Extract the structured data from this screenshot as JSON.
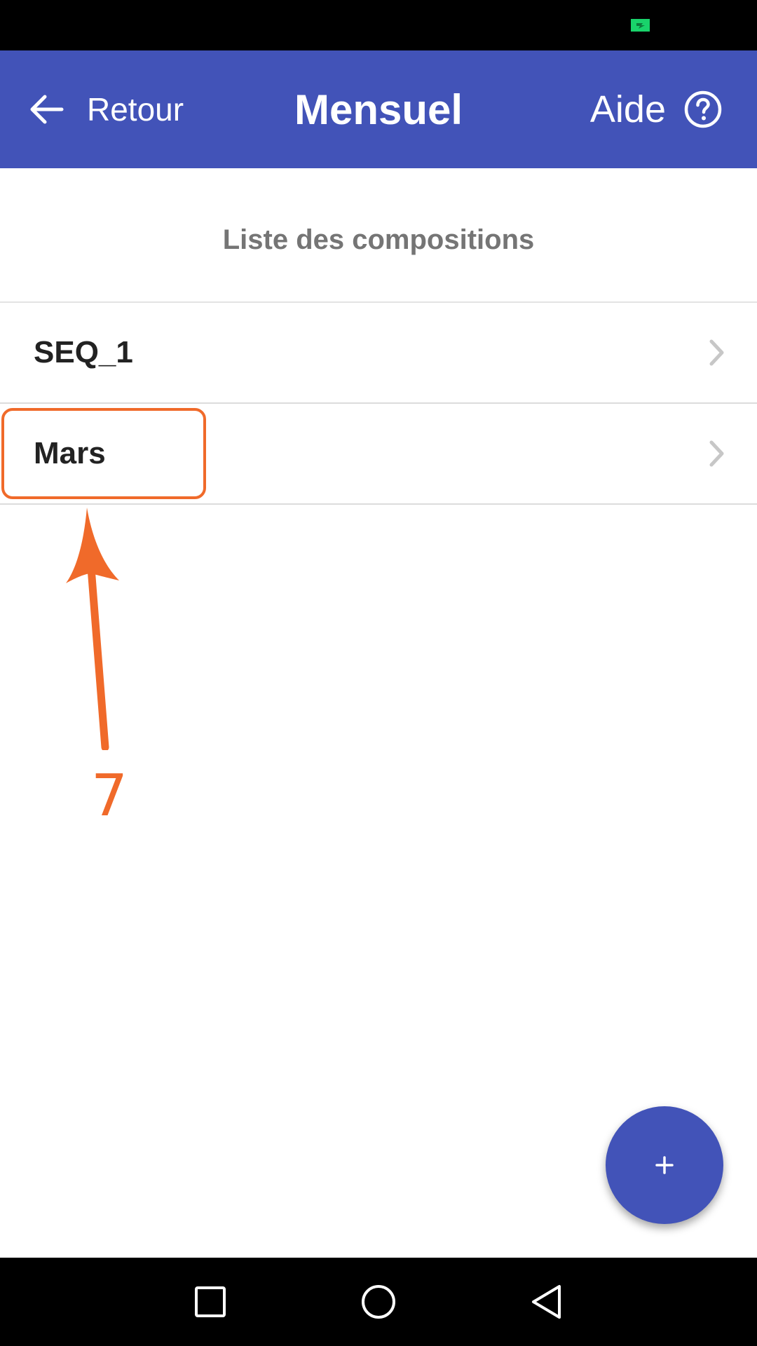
{
  "status_bar": {
    "battery_icon": "battery-charging-icon",
    "battery_color": "#19d36b"
  },
  "app_bar": {
    "back_label": "Retour",
    "title": "Mensuel",
    "help_label": "Aide",
    "background_color": "#4253b8"
  },
  "section": {
    "title": "Liste des compositions"
  },
  "compositions": [
    {
      "label": "SEQ_1"
    },
    {
      "label": "Mars"
    }
  ],
  "annotation": {
    "step_number": "7",
    "color": "#f06a2a"
  },
  "fab": {
    "icon": "plus-icon"
  },
  "nav_bar": {
    "icons": [
      "recent-apps-icon",
      "home-icon",
      "back-triangle-icon"
    ]
  }
}
